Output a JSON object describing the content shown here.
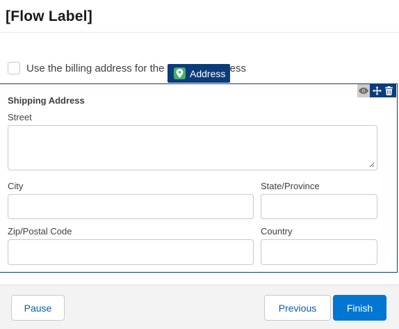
{
  "header": {
    "title": "[Flow Label]"
  },
  "billing": {
    "checkbox_label": "Use the billing address for the shipping address",
    "checked": false
  },
  "component_tag": {
    "label": "Address",
    "icon": "location-pin-icon",
    "icon_color": "#47b06a",
    "bg_color": "#0b3c7a"
  },
  "address": {
    "title": "Shipping Address",
    "street_label": "Street",
    "city_label": "City",
    "state_label": "State/Province",
    "zip_label": "Zip/Postal Code",
    "country_label": "Country",
    "street_value": "",
    "city_value": "",
    "state_value": "",
    "zip_value": "",
    "country_value": ""
  },
  "footer": {
    "pause": "Pause",
    "previous": "Previous",
    "finish": "Finish",
    "brand_color": "#0176d3"
  }
}
